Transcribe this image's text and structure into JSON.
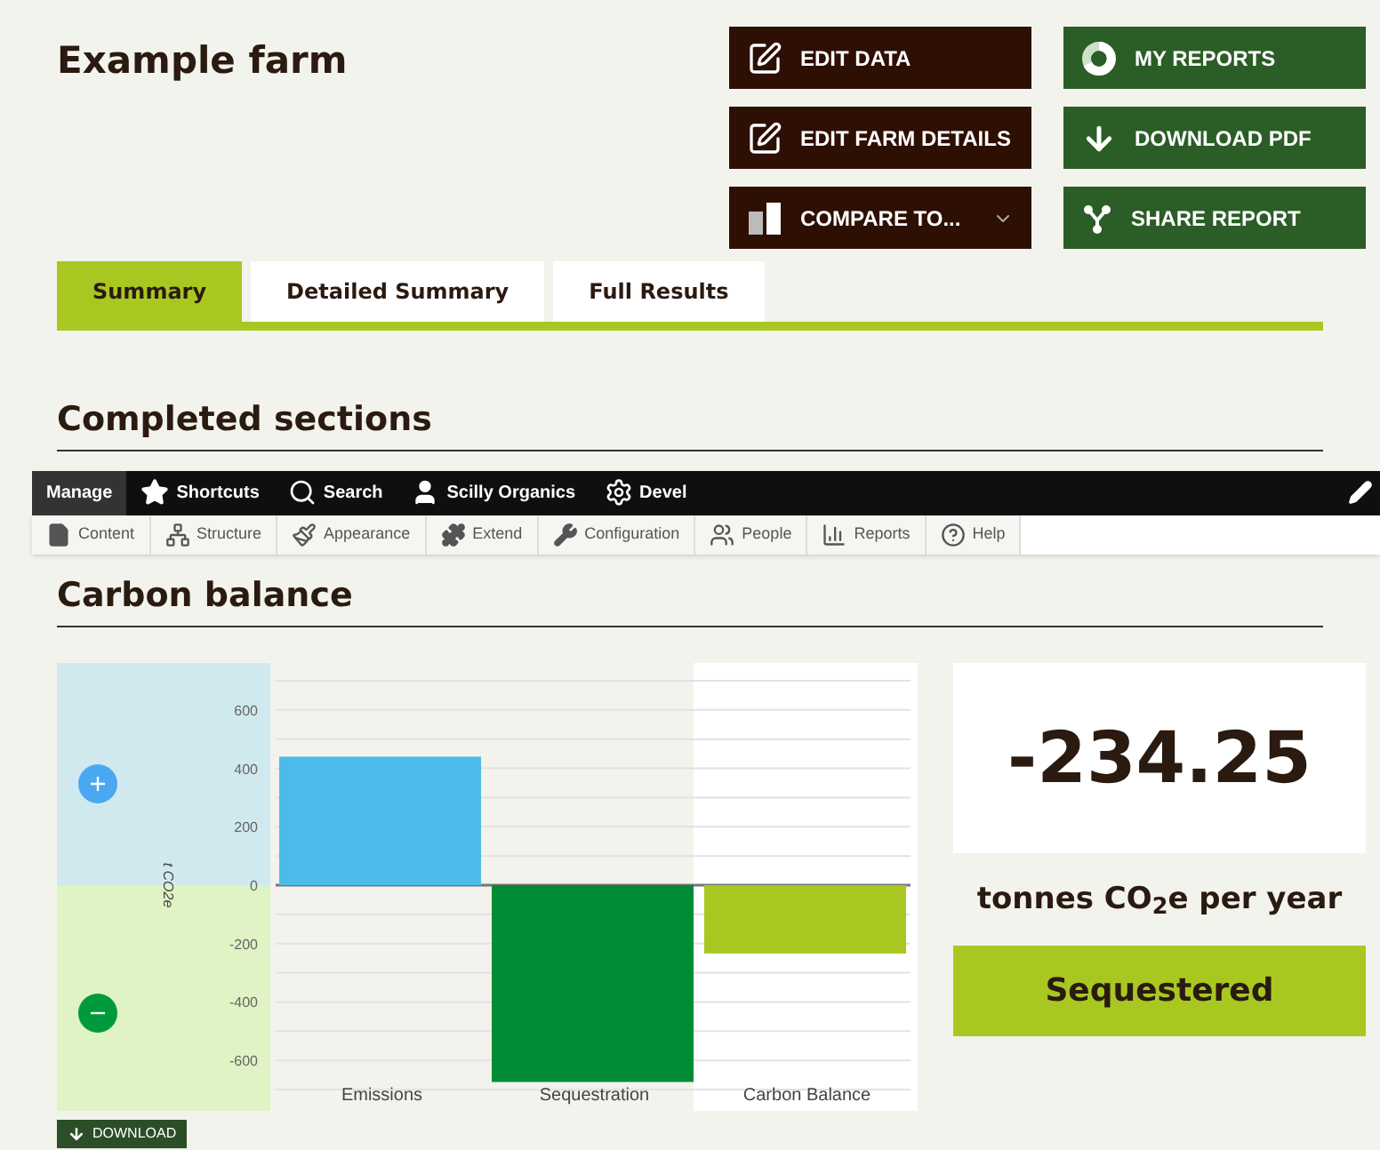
{
  "page_title": "Example farm",
  "actions": [
    {
      "label": "EDIT DATA",
      "kind": "edit",
      "color": "#2e0f04"
    },
    {
      "label": "MY REPORTS",
      "kind": "reports",
      "color": "#2b5d27"
    },
    {
      "label": "EDIT FARM DETAILS",
      "kind": "edit",
      "color": "#2e0f04"
    },
    {
      "label": "DOWNLOAD PDF",
      "kind": "download",
      "color": "#2b5d27"
    },
    {
      "label": "COMPARE TO...",
      "kind": "compare",
      "color": "#2e0f04"
    },
    {
      "label": "SHARE REPORT",
      "kind": "share",
      "color": "#2b5d27"
    }
  ],
  "tabs": [
    {
      "label": "Summary",
      "selected": true
    },
    {
      "label": "Detailed Summary",
      "selected": false
    },
    {
      "label": "Full Results",
      "selected": false
    }
  ],
  "completed_heading": "Completed sections",
  "admin_toolbar": {
    "items": [
      {
        "label": "Manage",
        "kind": "manage",
        "selected": true
      },
      {
        "label": "Shortcuts",
        "kind": "star",
        "selected": false
      },
      {
        "label": "Search",
        "kind": "search",
        "selected": false
      },
      {
        "label": "Scilly Organics",
        "kind": "user",
        "selected": false
      },
      {
        "label": "Devel",
        "kind": "gear",
        "selected": false
      }
    ],
    "menu": [
      {
        "label": "Content",
        "kind": "file"
      },
      {
        "label": "Structure",
        "kind": "structure"
      },
      {
        "label": "Appearance",
        "kind": "brush"
      },
      {
        "label": "Extend",
        "kind": "puzzle"
      },
      {
        "label": "Configuration",
        "kind": "wrench"
      },
      {
        "label": "People",
        "kind": "people"
      },
      {
        "label": "Reports",
        "kind": "bars"
      },
      {
        "label": "Help",
        "kind": "help"
      }
    ]
  },
  "carbon_heading": "Carbon balance",
  "chart": {
    "chart_data": {
      "type": "bar",
      "ylabel": "t CO2e",
      "categories": [
        "Emissions",
        "Sequestration",
        "Carbon Balance"
      ],
      "values": [
        440,
        -674,
        -234
      ],
      "colors": [
        "#4cbbea",
        "#008c36",
        "#a8c821"
      ],
      "grid": true,
      "ylim": [
        -700,
        700
      ],
      "yticks": [
        -600,
        -400,
        -200,
        0,
        200,
        400,
        600
      ]
    },
    "download_label": "DOWNLOAD"
  },
  "result": {
    "value": "-234.25",
    "unit": "tonnes CO$_{2}$e per year",
    "status": "Sequestered"
  }
}
